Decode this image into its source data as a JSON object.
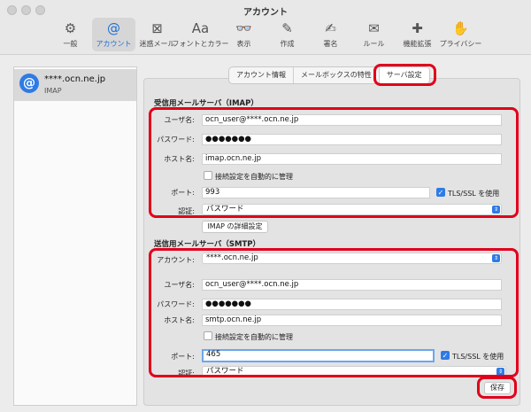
{
  "window": {
    "title": "アカウント"
  },
  "toolbar": {
    "items": [
      {
        "label": "一般",
        "icon": "gear-icon",
        "glyph": "⚙"
      },
      {
        "label": "アカウント",
        "icon": "at-icon",
        "glyph": "@"
      },
      {
        "label": "迷惑メール",
        "icon": "junk-icon",
        "glyph": "⊠"
      },
      {
        "label": "フォントとカラー",
        "icon": "font-icon",
        "glyph": "Aa"
      },
      {
        "label": "表示",
        "icon": "glasses-icon",
        "glyph": "👓"
      },
      {
        "label": "作成",
        "icon": "compose-icon",
        "glyph": "✎"
      },
      {
        "label": "署名",
        "icon": "signature-icon",
        "glyph": "✍"
      },
      {
        "label": "ルール",
        "icon": "rules-icon",
        "glyph": "✉"
      },
      {
        "label": "機能拡張",
        "icon": "puzzle-icon",
        "glyph": "✚"
      },
      {
        "label": "プライバシー",
        "icon": "hand-icon",
        "glyph": "✋"
      }
    ]
  },
  "sidebar": {
    "account": {
      "name": "****.ocn.ne.jp",
      "type": "IMAP"
    }
  },
  "tabs": [
    {
      "label": "アカウント情報"
    },
    {
      "label": "メールボックスの特性"
    },
    {
      "label": "サーバ設定"
    }
  ],
  "incoming": {
    "title": "受信用メールサーバ（IMAP）",
    "username_label": "ユーザ名:",
    "username": "ocn_user@****.ocn.ne.jp",
    "password_label": "パスワード:",
    "password": "●●●●●●●",
    "host_label": "ホスト名:",
    "host": "imap.ocn.ne.jp",
    "auto_manage_label": "接続設定を自動的に管理",
    "port_label": "ポート:",
    "port": "993",
    "tls_label": "TLS/SSL を使用",
    "auth_label": "認証:",
    "auth": "パスワード",
    "advanced_button": "IMAP の詳細設定"
  },
  "outgoing": {
    "title": "送信用メールサーバ（SMTP）",
    "account_label": "アカウント:",
    "account": "****.ocn.ne.jp",
    "username_label": "ユーザ名:",
    "username": "ocn_user@****.ocn.ne.jp",
    "password_label": "パスワード:",
    "password": "●●●●●●●",
    "host_label": "ホスト名:",
    "host": "smtp.ocn.ne.jp",
    "auto_manage_label": "接続設定を自動的に管理",
    "port_label": "ポート:",
    "port": "465",
    "tls_label": "TLS/SSL を使用",
    "auth_label": "認証:",
    "auth": "パスワード"
  },
  "save_button": "保存",
  "colors": {
    "accent": "#2f7be6",
    "highlight": "#e0001b"
  }
}
